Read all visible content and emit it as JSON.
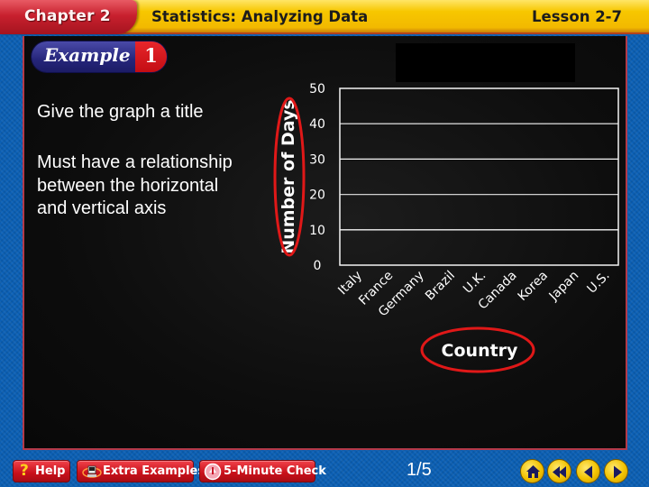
{
  "header": {
    "chapter": "Chapter 2",
    "title": "Statistics: Analyzing Data",
    "lesson": "Lesson 2-7"
  },
  "example": {
    "label": "Example",
    "number": "1"
  },
  "bullets": [
    "Give the graph a title",
    "Must have a relationship between the horizontal and vertical axis"
  ],
  "chart_data": {
    "type": "bar",
    "title": "",
    "xlabel": "Country",
    "ylabel": "Number of Days",
    "categories": [
      "Italy",
      "France",
      "Germany",
      "Brazil",
      "U.K.",
      "Canada",
      "Korea",
      "Japan",
      "U.S."
    ],
    "values": [],
    "ylim": [
      0,
      50
    ],
    "yticks": [
      0,
      10,
      20,
      30,
      40,
      50
    ],
    "grid": true,
    "annotations": [
      "ylabel circled in red",
      "xlabel circled in red"
    ],
    "colors": {
      "grid": "#ffffff",
      "highlight": "#e01818"
    }
  },
  "toolbar": {
    "help": "Help",
    "extra_examples": "Extra Examples",
    "five_minute_check": "5-Minute Check",
    "page": "1/5",
    "nav": [
      "home-icon",
      "first-icon",
      "previous-icon",
      "next-icon"
    ]
  }
}
